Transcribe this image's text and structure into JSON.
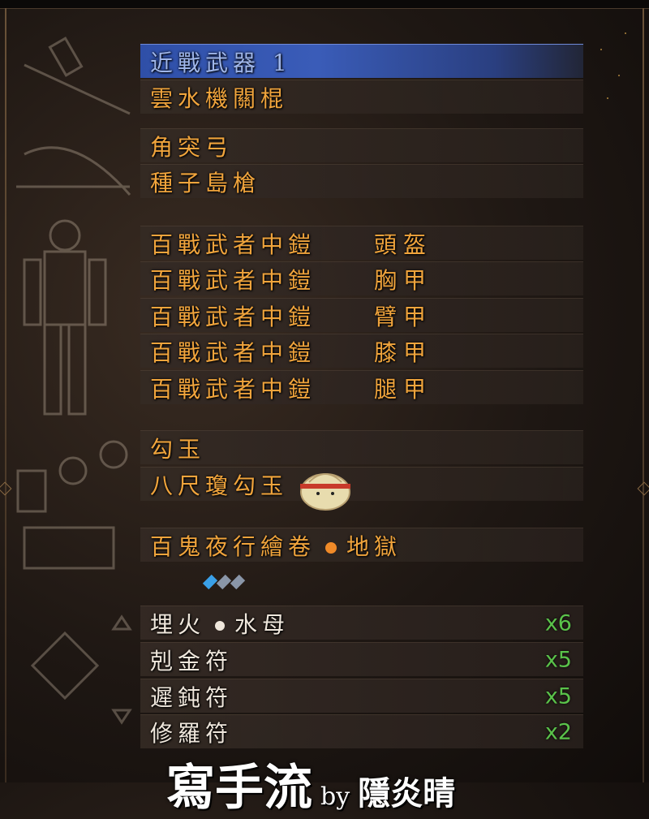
{
  "equipment": {
    "melee_header": "近戰武器 1",
    "melee_weapon": "雲水機關棍",
    "ranged": [
      "角突弓",
      "種子島槍"
    ],
    "armor": [
      {
        "set": "百戰武者中鎧",
        "part": "頭盔"
      },
      {
        "set": "百戰武者中鎧",
        "part": "胸甲"
      },
      {
        "set": "百戰武者中鎧",
        "part": "臂甲"
      },
      {
        "set": "百戰武者中鎧",
        "part": "膝甲"
      },
      {
        "set": "百戰武者中鎧",
        "part": "腿甲"
      }
    ],
    "accessories": [
      "勾玉",
      "八尺瓊勾玉"
    ],
    "scroll": {
      "name_a": "百鬼夜行繪卷",
      "name_b": "地獄"
    },
    "consumables": [
      {
        "name_a": "埋火",
        "name_b": "水母",
        "qty": "x6"
      },
      {
        "name": "剋金符",
        "qty": "x5"
      },
      {
        "name": "遲鈍符",
        "qty": "x5"
      },
      {
        "name": "修羅符",
        "qty": "x2"
      }
    ]
  },
  "gems": {
    "count": 3,
    "colors": [
      "#3aa0e8",
      "#8a96a8",
      "#8a96a8"
    ]
  },
  "watermark": {
    "main": "寫手流",
    "by": "by",
    "author": "隱炎晴"
  },
  "colors": {
    "accent_orange": "#f0a43c",
    "selected_blue": "#3a5cb8",
    "qty_green": "#5ac24a"
  }
}
